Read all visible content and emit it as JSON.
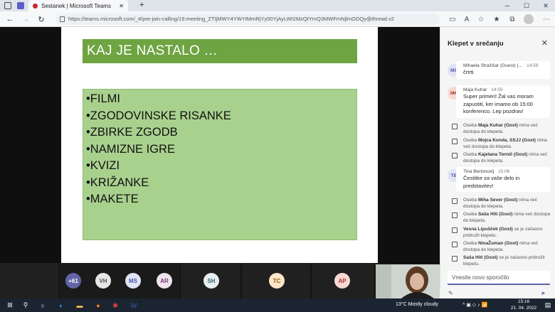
{
  "browser": {
    "tab_title": "Sestanek | Microsoft Teams",
    "new_tab": "+",
    "url": "https://teams.microsoft.com/_#/pre-join-calling/19:meeting_ZTIjMWY4YWYtMmRjYy00YjAyLWI2MzQtYmQ3MWFmNjlmODQy@thread.v2",
    "minimize": "─",
    "maximize": "☐",
    "close": "✕"
  },
  "slide": {
    "title": "KAJ JE NASTALO …",
    "bullets": [
      "•FILMI",
      "•ZGODOVINSKE RISANKE",
      "•ZBIRKE ZGODB",
      "•NAMIZNE IGRE",
      "•KVIZI",
      "•KRIŽANKE",
      "•MAKETE"
    ]
  },
  "chat": {
    "title": "Klepet v srečanju",
    "close": "✕",
    "messages": [
      {
        "initials": "MS",
        "author": "Mihaela Stražišar (Guest) (...",
        "time": "14:59",
        "text": "črtrti"
      },
      {
        "initials": "MK",
        "author": "Maja Kuhar",
        "time": "14:59",
        "text": "Super primeri! Žal vas moram zapustiti, ker imamo ob 15:00 konferenco. Lep pozdrav!"
      },
      {
        "initials": "TB",
        "author": "Tina Bertoncelj",
        "time": "15:06",
        "text": "Čestitke za vaše delo in predstavitev!"
      }
    ],
    "system_top": [
      {
        "pre": "Oseba ",
        "name": "Maja Kuhar (Gost)",
        "post": " nima več dostopa do klepeta."
      },
      {
        "pre": "Oseba ",
        "name": "Mojca Konda, SSJJ (Gost)",
        "post": " nima več dostopa do klepeta."
      },
      {
        "pre": "Oseba ",
        "name": "Kajetana Tornič (Gost)",
        "post": " nima več dostopa do klepeta."
      }
    ],
    "system_bottom": [
      {
        "pre": "Oseba ",
        "name": "Miha Sever (Gost)",
        "post": " nima več dostopa do klepeta."
      },
      {
        "pre": "Oseba ",
        "name": "Saša Hiti (Gost)",
        "post": " nima več dostopa do klepeta."
      },
      {
        "pre": "",
        "name": "Vesna Lipušček (Gost)",
        "post": " se je začasno pridružil klepetu."
      },
      {
        "pre": "Oseba ",
        "name": "NinaŽuman (Gost)",
        "post": " nima več dostopa do klepeta."
      },
      {
        "pre": "",
        "name": "Saša Hiti (Gost)",
        "post": " se je začasno pridružil klepetu."
      }
    ],
    "compose_placeholder": "Vnesite novo sporočilo"
  },
  "participants": [
    {
      "label": "+61",
      "bg": "#6264a7",
      "fg": "#ffffff"
    },
    {
      "label": "VH",
      "bg": "#e6e6e6",
      "fg": "#555555"
    },
    {
      "label": "MS",
      "bg": "#dfe3f3",
      "fg": "#4f52b2"
    },
    {
      "label": "AR",
      "bg": "#efe3ee",
      "fg": "#7a3b76"
    },
    {
      "label": "SH",
      "bg": "#e6eef0",
      "fg": "#3a6672"
    },
    {
      "label": "TC",
      "bg": "#fbe6c8",
      "fg": "#8a5a12"
    },
    {
      "label": "AP",
      "bg": "#f7d8d2",
      "fg": "#a33a2b"
    }
  ],
  "taskbar": {
    "weather": "13°C  Mostly cloudy",
    "time": "15:16",
    "date": "21. 04. 2022"
  },
  "colors": {
    "slide_title_bg": "#6ea442",
    "slide_body_bg": "#a9d18e",
    "teams_accent": "#6264a7"
  }
}
